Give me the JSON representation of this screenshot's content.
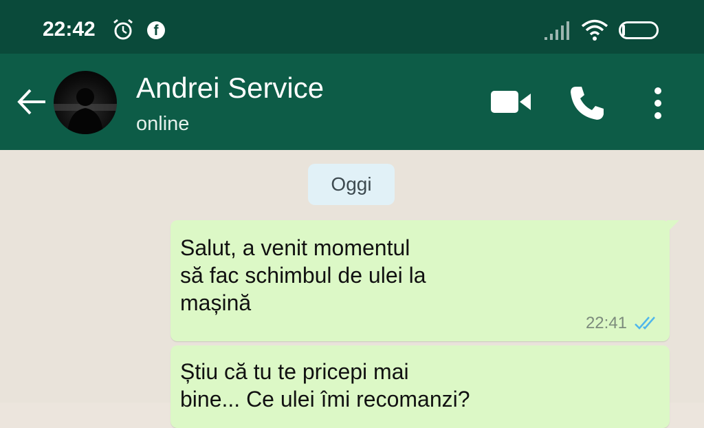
{
  "status_bar": {
    "time": "22:42",
    "alarm_icon": "alarm-clock-icon",
    "facebook_icon": "facebook-icon",
    "facebook_glyph": "f",
    "signal_icon": "cell-signal-icon",
    "wifi_icon": "wifi-icon",
    "battery_level": "9",
    "battery_fraction": 0.09
  },
  "header": {
    "back_icon": "back-arrow-icon",
    "contact_name": "Andrei Service",
    "contact_status": "online",
    "video_call_icon": "video-camera-icon",
    "voice_call_icon": "phone-icon",
    "menu_icon": "vertical-dots-menu-icon",
    "color": "#0d5c47"
  },
  "chat": {
    "date_label": "Oggi",
    "messages": [
      {
        "text": "Salut, a venit momentul\nsă fac schimbul de ulei la\nmașină",
        "time": "22:41",
        "status_icon": "double-check-read-icon",
        "direction": "outgoing"
      },
      {
        "text": "Știu că tu te pricepi mai\nbine... Ce ulei îmi recomanzi?",
        "direction": "outgoing"
      }
    ],
    "outgoing_bubble_color": "#dcf8c6",
    "read_tick_color": "#4fb6ec"
  }
}
